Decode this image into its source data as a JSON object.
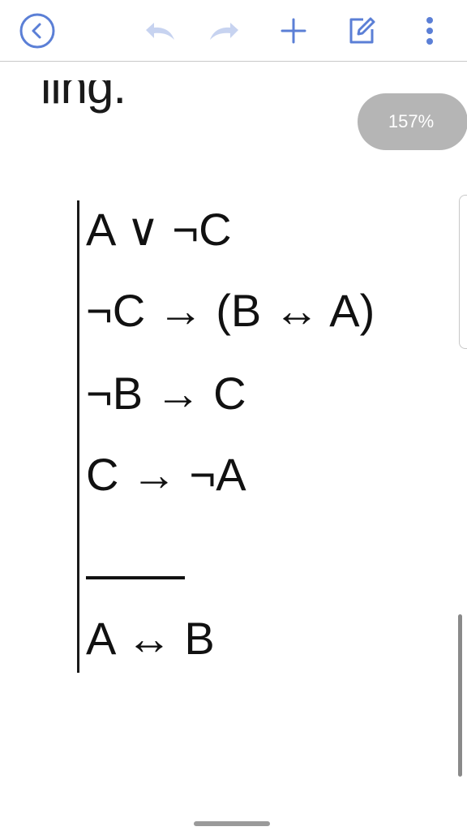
{
  "toolbar": {
    "icons": [
      "back-icon",
      "undo-icon",
      "redo-icon",
      "plus-icon",
      "edit-icon",
      "more-vert-icon"
    ],
    "accent_color": "#5b7fd6",
    "disabled_color": "#c7d3f0"
  },
  "document": {
    "partial_text": "ling.",
    "zoom": "157%",
    "premises": [
      "A ∨ ¬C",
      "¬C → (B ↔ A)",
      "¬B → C",
      "C → ¬A"
    ],
    "conclusion": "A ↔ B"
  }
}
